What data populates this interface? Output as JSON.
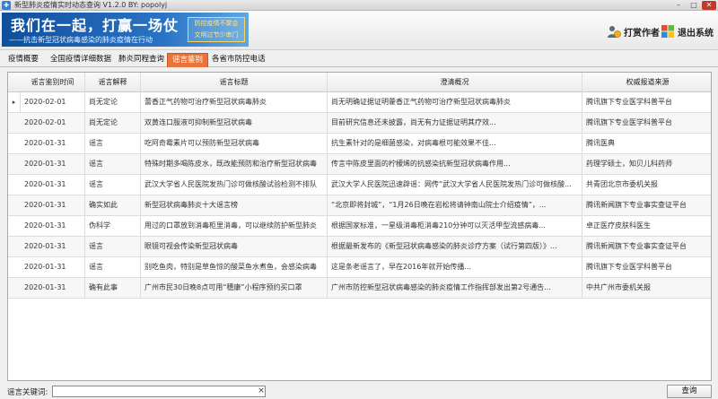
{
  "window": {
    "title": "新型肺炎疫情实时动态查询 V1.2.0    BY:  popolyj",
    "minimize": "–",
    "maximize": "□",
    "close": "✕"
  },
  "banner": {
    "slogan": "我们在一起，打赢一场仗",
    "subtitle": "——抗击新型冠状病毒感染的肺炎疫情在行动",
    "badge_line1": "防控疫情不聚会",
    "badge_line2": "文明过节少串门"
  },
  "header_buttons": {
    "tip_author": "打赏作者",
    "exit": "退出系统"
  },
  "tabs": [
    {
      "label": "疫情概要"
    },
    {
      "label": "全国疫情详细数据"
    },
    {
      "label": "肺炎同程查询"
    },
    {
      "label": "谣言鉴别"
    },
    {
      "label": "各省市防控电话"
    }
  ],
  "table": {
    "columns": [
      "谣言鉴别时间",
      "谣言解释",
      "谣言标题",
      "澄清概况",
      "权威报道来源"
    ],
    "current_row_marker": "▸",
    "rows": [
      [
        "2020-02-01",
        "尚无定论",
        "蕾香正气药物可治疗新型冠状病毒肺炎",
        "尚无明确证据证明藿香正气药物可治疗新型冠状病毒肺炎",
        "腾讯旗下专业医学科普平台"
      ],
      [
        "2020-02-01",
        "尚无定论",
        "双黄连口服液可抑制新型冠状病毒",
        "目前研究信息还未披露，尚无有力证据证明其疗效...",
        "腾讯旗下专业医学科普平台"
      ],
      [
        "2020-01-31",
        "谣言",
        "吃阿奇霉素片可以预防新型冠状病毒",
        "抗生素针对的是细菌感染，对病毒根可能效果不佳...",
        "腾讯医典"
      ],
      [
        "2020-01-31",
        "谣言",
        "特殊时期多喝陈皮水，既改能预防和治疗新型冠状病毒",
        "传言中陈皮里面的柠檬烯的抗感染抗新型冠状病毒作用...",
        "药理学硕士，知贝儿科药师"
      ],
      [
        "2020-01-31",
        "谣言",
        "武汉大学省人民医院发热门诊可做核酸试验检测不排队",
        "武汉大学人民医院迅速辟谣：网传“武汉大学省人民医院发热门诊可做核酸...",
        "共青团北京市委机关报"
      ],
      [
        "2020-01-31",
        "确实如此",
        "新型冠状病毒肺炎十大谣言榜",
        "“北京即将封城”，“1月26日晚在岩松将请钟南山院士介绍疫情”，...",
        "腾讯新闻旗下专业事实查证平台"
      ],
      [
        "2020-01-31",
        "伪科学",
        "用过的口罩放到消毒柜里消毒，可以继续防护新型肺炎",
        "根据国家标准，一星级消毒柜消毒210分钟可以灭活甲型流感病毒...",
        "卓正医疗皮肤科医生"
      ],
      [
        "2020-01-31",
        "谣言",
        "眼镜可视会传染新型冠状病毒",
        "根据最新发布的《新型冠状病毒感染的肺炎诊疗方案（试行第四版）》...",
        "腾讯新闻旗下专业事实查证平台"
      ],
      [
        "2020-01-31",
        "谣言",
        "别吃鱼肉，特别是草鱼惊的酸菜鱼水煮鱼，会感染病毒",
        "这是条老谣言了，早在2016年就开始传播...",
        "腾讯旗下专业医学科普平台"
      ],
      [
        "2020-01-31",
        "确有此事",
        "广州市民30日晚8点可用“穗康”小程序预约买口罩",
        "广州市防控新型冠状病毒感染的肺炎疫情工作指挥部发出第2号通告...",
        "中共广州市委机关报"
      ]
    ]
  },
  "search": {
    "label": "谣言关键词:",
    "value": "",
    "placeholder": "",
    "clear_glyph": "×",
    "button": "查询"
  },
  "colors": {
    "banner_blue": "#1a5fae",
    "active_tab": "#e8743b",
    "close_button": "#c0392b"
  },
  "icons": {
    "tip_author": "user-coin-icon",
    "exit": "windows-logo-icon"
  }
}
